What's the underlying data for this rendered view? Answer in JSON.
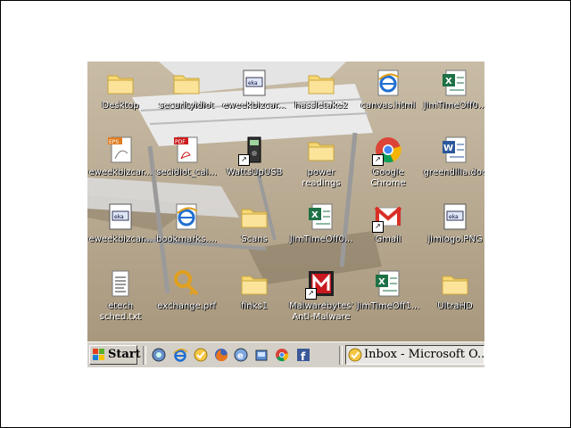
{
  "desktop": {
    "icons": [
      {
        "label": "Desktop",
        "icon": "folder-icon"
      },
      {
        "label": "securityidiot",
        "icon": "folder-icon"
      },
      {
        "label": "eweekbizcar...",
        "icon": "image-file-icon"
      },
      {
        "label": "hassletake2",
        "icon": "folder-icon"
      },
      {
        "label": "canvas.html",
        "icon": "ie-html-file-icon"
      },
      {
        "label": "JimTimeOff0...",
        "icon": "excel-file-icon"
      },
      {
        "label": "eweekbizcar...",
        "icon": "eps-file-icon"
      },
      {
        "label": "secidiot_cal...",
        "icon": "pdf-file-icon"
      },
      {
        "label": "WattsUpUSB",
        "icon": "device-shortcut-icon"
      },
      {
        "label": "power",
        "label2": "readings",
        "icon": "folder-icon"
      },
      {
        "label": "Google",
        "label2": "Chrome",
        "icon": "chrome-icon"
      },
      {
        "label": "greendilla.doc",
        "icon": "word-file-icon"
      },
      {
        "label": "eweekbizcar...",
        "icon": "image-file-icon"
      },
      {
        "label": "bookmarks....",
        "icon": "ie-html-file-icon"
      },
      {
        "label": "Scans",
        "icon": "folder-icon"
      },
      {
        "label": "JimTimeOff0...",
        "icon": "excel-file-icon"
      },
      {
        "label": "Gmail",
        "icon": "gmail-icon"
      },
      {
        "label": "jimlogo.PNG",
        "icon": "image-file-icon"
      },
      {
        "label": "etech",
        "label2": "sched.txt",
        "icon": "text-file-icon"
      },
      {
        "label": "exchange.prf",
        "icon": "key-file-icon"
      },
      {
        "label": "finks1",
        "icon": "folder-icon"
      },
      {
        "label": "Malwarebytes'",
        "label2": "Anti-Malware",
        "icon": "malwarebytes-icon"
      },
      {
        "label": "JimTimeOff1...",
        "icon": "excel-file-icon"
      },
      {
        "label": "UltraHD",
        "icon": "folder-icon"
      }
    ]
  },
  "taskbar": {
    "start_label": "Start",
    "quick_launch": [
      "show-desktop-icon",
      "internet-explorer-icon",
      "outlook-icon",
      "firefox-icon",
      "ie-alt-icon",
      "windows-explorer-icon",
      "chrome-icon",
      "facebook-icon"
    ],
    "tasks": [
      {
        "label": "Inbox - Microsoft O...",
        "icon": "outlook-icon"
      }
    ]
  },
  "colors": {
    "taskbar": "#d4d0c8",
    "folder": "#f6d774",
    "excel": "#1e7145",
    "word": "#2b579a",
    "pdf": "#cc1f1f"
  }
}
